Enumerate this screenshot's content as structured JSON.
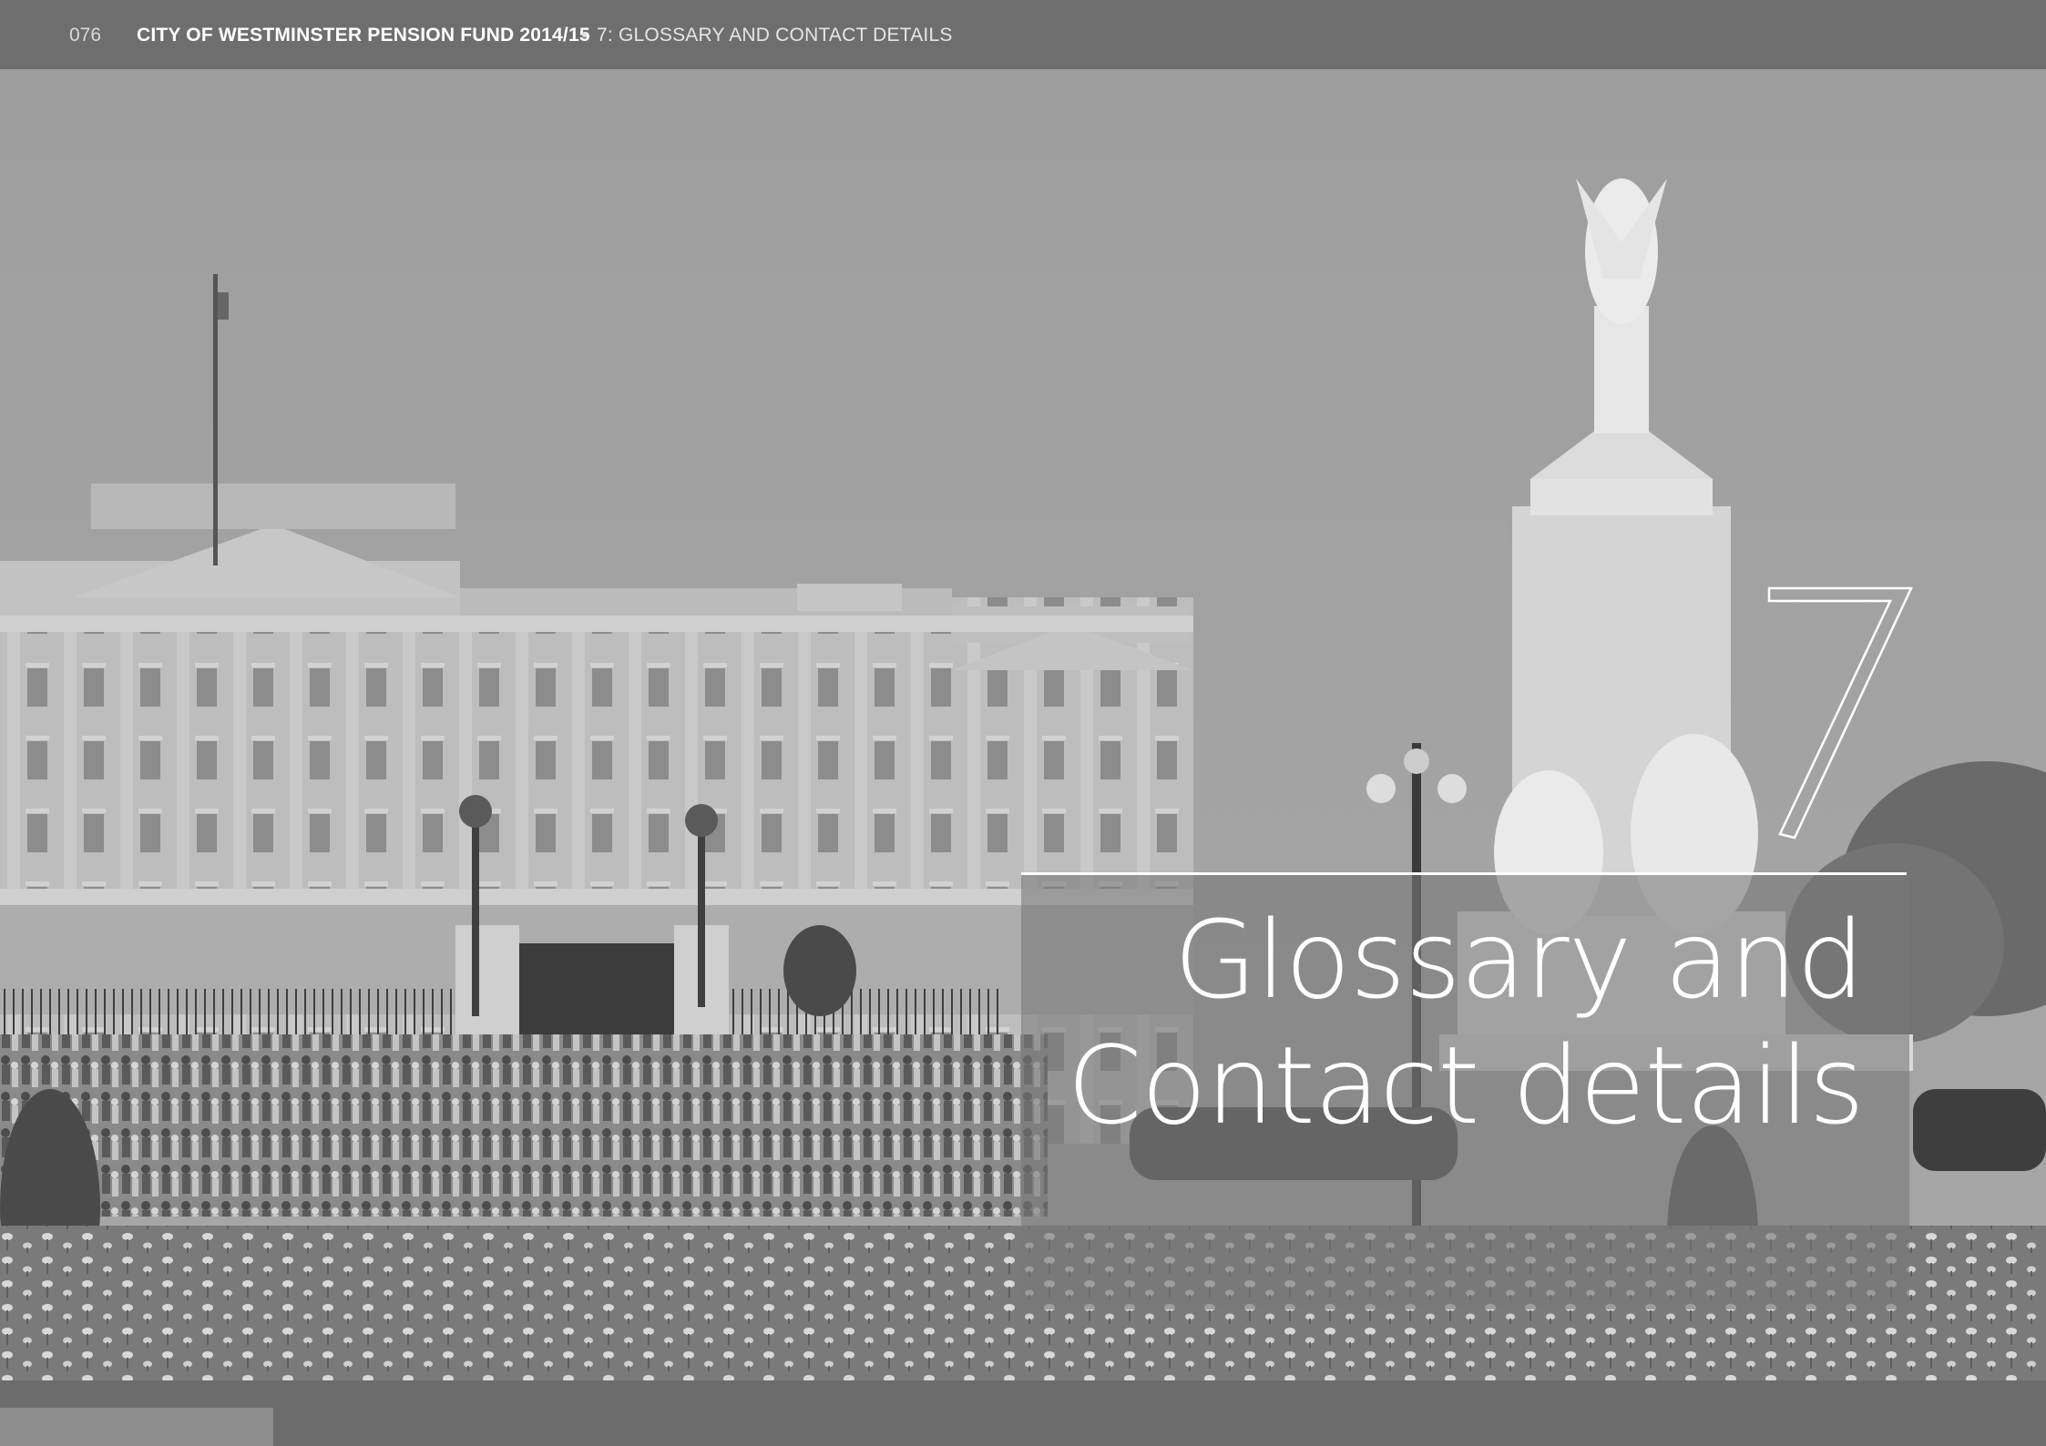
{
  "header": {
    "page_number": "076",
    "title": "CITY OF WESTMINSTER PENSION FUND 2014/15",
    "separator": "•",
    "section": "7: GLOSSARY AND CONTACT DETAILS"
  },
  "chapter": {
    "number": "7",
    "heading_line1": "Glossary and",
    "heading_line2": "Contact details"
  },
  "photo": {
    "subject": "Buckingham Palace and the Victoria Memorial with crowds and tulip beds",
    "tone": "greyscale"
  },
  "colors": {
    "header_bg": "#6e6e6e",
    "header_text": "#ffffff",
    "overlay": "#787878",
    "heading_text": "#ffffff"
  }
}
